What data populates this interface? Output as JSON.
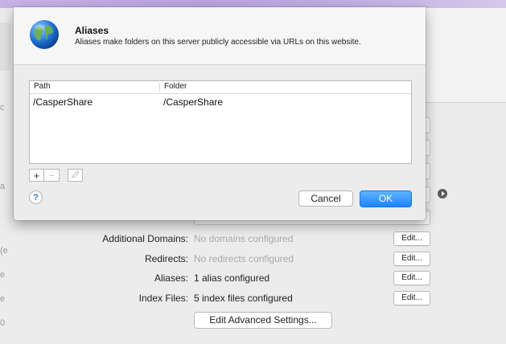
{
  "dialog": {
    "title": "Aliases",
    "description": "Aliases make folders on this server publicly accessible via URLs on this website.",
    "icon": "globe-icon",
    "table": {
      "headers": [
        "Path",
        "Folder"
      ],
      "rows": [
        {
          "path": "/CasperShare",
          "folder": "/CasperShare"
        }
      ]
    },
    "add_label": "+",
    "remove_label": "−",
    "help_label": "?",
    "cancel_label": "Cancel",
    "ok_label": "OK",
    "accent_color": "#1d85fb"
  },
  "settings": {
    "rows": [
      {
        "label": "Additional Domains:",
        "value": "No domains configured",
        "edit": "Edit..."
      },
      {
        "label": "Redirects:",
        "value": "No redirects configured",
        "edit": "Edit..."
      },
      {
        "label": "Aliases:",
        "value": "1 alias configured",
        "edit": "Edit..."
      },
      {
        "label": "Index Files:",
        "value": "5 index files configured",
        "edit": "Edit..."
      }
    ],
    "advanced_label": "Edit Advanced Settings..."
  },
  "background_fragments": {
    "left_letters": [
      "c",
      "a",
      "(e",
      "e",
      "e",
      "0"
    ]
  }
}
